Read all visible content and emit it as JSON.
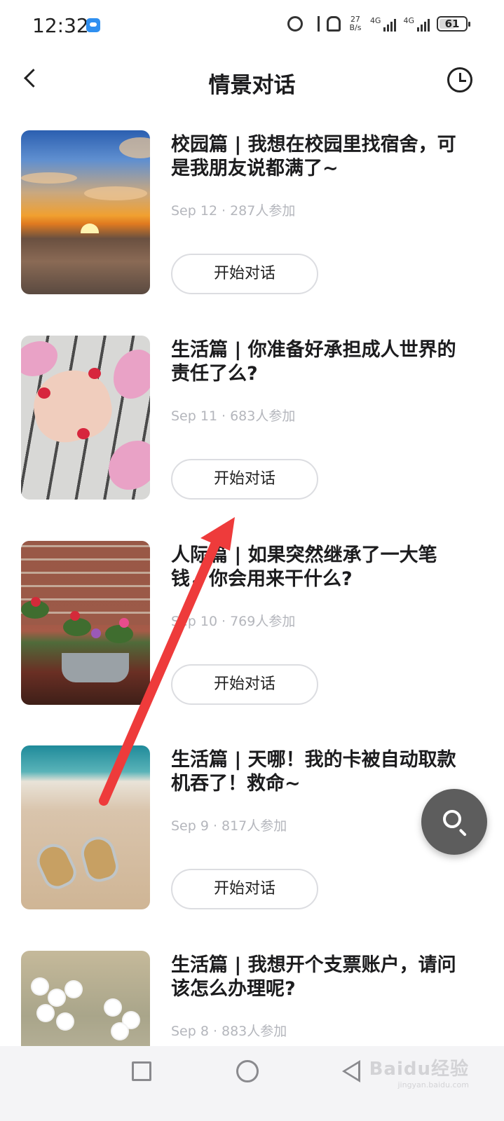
{
  "status_bar": {
    "time": "12:32",
    "net_speed_top": "27",
    "net_speed_bottom": "B/s",
    "sim1": "4G",
    "sim2": "4G",
    "battery_percent": "61",
    "battery_level": 0.61
  },
  "header": {
    "title": "情景对话"
  },
  "dialogues": [
    {
      "title": "校园篇 | 我想在校园里找宿舍，可是我朋友说都满了~",
      "date": "Sep 12",
      "separator": "·",
      "participants": "287人参加",
      "button": "开始对话"
    },
    {
      "title": "生活篇 | 你准备好承担成人世界的责任了么?",
      "date": "Sep 11",
      "separator": "·",
      "participants": "683人参加",
      "button": "开始对话"
    },
    {
      "title": "人际篇 | 如果突然继承了一大笔钱，你会用来干什么?",
      "date": "Sep 10",
      "separator": "·",
      "participants": "769人参加",
      "button": "开始对话"
    },
    {
      "title": "生活篇 | 天哪！我的卡被自动取款机吞了！救命~",
      "date": "Sep 9",
      "separator": "·",
      "participants": "817人参加",
      "button": "开始对话"
    },
    {
      "title": "生活篇 | 我想开个支票账户，请问该怎么办理呢?",
      "date": "Sep 8",
      "separator": "·",
      "participants": "883人参加",
      "button": ""
    }
  ],
  "watermark": {
    "brand": "Baidu经验",
    "url": "jingyan.baidu.com"
  },
  "colors": {
    "annotation_arrow": "#ee3b3b",
    "fab": "#5d5d5d",
    "meta_text": "#b4b6bc"
  }
}
